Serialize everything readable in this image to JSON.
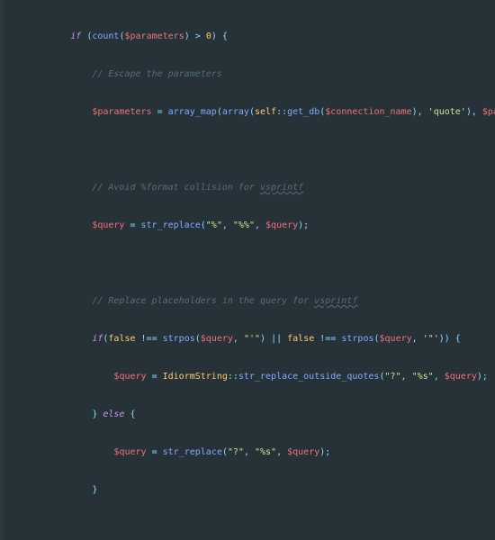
{
  "colors": {
    "background": "#263238",
    "gutter": "#2b373d",
    "keyword": "#C792EA",
    "function": "#82AAFF",
    "variable": "#f07178",
    "string": "#C3E88D",
    "punctuation": "#89DDFF",
    "class": "#FFCB6B",
    "comment": "#546E7A"
  },
  "lines": [
    {
      "indent": 3,
      "segments": [
        {
          "t": "kw",
          "v": "if "
        },
        {
          "t": "punc",
          "v": "("
        },
        {
          "t": "fn",
          "v": "count"
        },
        {
          "t": "punc",
          "v": "("
        },
        {
          "t": "var",
          "v": "$parameters"
        },
        {
          "t": "punc",
          "v": ")"
        },
        {
          "t": "op",
          "v": " > "
        },
        {
          "t": "cls",
          "v": "0"
        },
        {
          "t": "punc",
          "v": ") {"
        }
      ]
    },
    {
      "indent": 4,
      "segments": [
        {
          "t": "comment",
          "v": "// Escape the parameters"
        }
      ]
    },
    {
      "indent": 4,
      "segments": [
        {
          "t": "var",
          "v": "$parameters"
        },
        {
          "t": "op",
          "v": " = "
        },
        {
          "t": "fn",
          "v": "array_map"
        },
        {
          "t": "punc",
          "v": "("
        },
        {
          "t": "fn",
          "v": "array"
        },
        {
          "t": "punc",
          "v": "("
        },
        {
          "t": "cls",
          "v": "self"
        },
        {
          "t": "op",
          "v": "::"
        },
        {
          "t": "fn",
          "v": "get_db"
        },
        {
          "t": "punc",
          "v": "("
        },
        {
          "t": "var",
          "v": "$connection_name"
        },
        {
          "t": "punc",
          "v": "), "
        },
        {
          "t": "str",
          "v": "'quote'"
        },
        {
          "t": "punc",
          "v": "), "
        },
        {
          "t": "var",
          "v": "$parameters"
        },
        {
          "t": "punc",
          "v": ");"
        }
      ]
    },
    {
      "indent": 0,
      "segments": [
        {
          "t": "punc",
          "v": ""
        }
      ]
    },
    {
      "indent": 4,
      "segments": [
        {
          "t": "comment",
          "v": "// Avoid %format collision for "
        },
        {
          "t": "comment",
          "v": "vsprintf",
          "u": true
        }
      ]
    },
    {
      "indent": 4,
      "segments": [
        {
          "t": "var",
          "v": "$query"
        },
        {
          "t": "op",
          "v": " = "
        },
        {
          "t": "fn",
          "v": "str_replace"
        },
        {
          "t": "punc",
          "v": "("
        },
        {
          "t": "str",
          "v": "\"%\""
        },
        {
          "t": "punc",
          "v": ", "
        },
        {
          "t": "str",
          "v": "\"%%\""
        },
        {
          "t": "punc",
          "v": ", "
        },
        {
          "t": "var",
          "v": "$query"
        },
        {
          "t": "punc",
          "v": ");"
        }
      ]
    },
    {
      "indent": 0,
      "segments": [
        {
          "t": "punc",
          "v": ""
        }
      ]
    },
    {
      "indent": 4,
      "segments": [
        {
          "t": "comment",
          "v": "// Replace placeholders in the query for "
        },
        {
          "t": "comment",
          "v": "vsprintf",
          "u": true
        }
      ]
    },
    {
      "indent": 4,
      "segments": [
        {
          "t": "kw",
          "v": "if"
        },
        {
          "t": "punc",
          "v": "("
        },
        {
          "t": "cls",
          "v": "false"
        },
        {
          "t": "op",
          "v": " !== "
        },
        {
          "t": "fn",
          "v": "strpos"
        },
        {
          "t": "punc",
          "v": "("
        },
        {
          "t": "var",
          "v": "$query"
        },
        {
          "t": "punc",
          "v": ", "
        },
        {
          "t": "str",
          "v": "\"'\""
        },
        {
          "t": "punc",
          "v": ")"
        },
        {
          "t": "op",
          "v": " || "
        },
        {
          "t": "cls",
          "v": "false"
        },
        {
          "t": "op",
          "v": " !== "
        },
        {
          "t": "fn",
          "v": "strpos"
        },
        {
          "t": "punc",
          "v": "("
        },
        {
          "t": "var",
          "v": "$query"
        },
        {
          "t": "punc",
          "v": ", "
        },
        {
          "t": "str",
          "v": "'\"'"
        },
        {
          "t": "punc",
          "v": ")) {"
        }
      ]
    },
    {
      "indent": 5,
      "segments": [
        {
          "t": "var",
          "v": "$query"
        },
        {
          "t": "op",
          "v": " = "
        },
        {
          "t": "cls",
          "v": "IdiormString"
        },
        {
          "t": "op",
          "v": "::"
        },
        {
          "t": "fn",
          "v": "str_replace_outside_quotes"
        },
        {
          "t": "punc",
          "v": "("
        },
        {
          "t": "str",
          "v": "\"?\""
        },
        {
          "t": "punc",
          "v": ", "
        },
        {
          "t": "str",
          "v": "\"%s\""
        },
        {
          "t": "punc",
          "v": ", "
        },
        {
          "t": "var",
          "v": "$query"
        },
        {
          "t": "punc",
          "v": ");"
        }
      ]
    },
    {
      "indent": 4,
      "segments": [
        {
          "t": "punc",
          "v": "} "
        },
        {
          "t": "kw",
          "v": "else"
        },
        {
          "t": "punc",
          "v": " {"
        }
      ]
    },
    {
      "indent": 5,
      "segments": [
        {
          "t": "var",
          "v": "$query"
        },
        {
          "t": "op",
          "v": " = "
        },
        {
          "t": "fn",
          "v": "str_replace"
        },
        {
          "t": "punc",
          "v": "("
        },
        {
          "t": "str",
          "v": "\"?\""
        },
        {
          "t": "punc",
          "v": ", "
        },
        {
          "t": "str",
          "v": "\"%s\""
        },
        {
          "t": "punc",
          "v": ", "
        },
        {
          "t": "var",
          "v": "$query"
        },
        {
          "t": "punc",
          "v": ");"
        }
      ]
    },
    {
      "indent": 4,
      "segments": [
        {
          "t": "punc",
          "v": "}"
        }
      ]
    }
  ]
}
